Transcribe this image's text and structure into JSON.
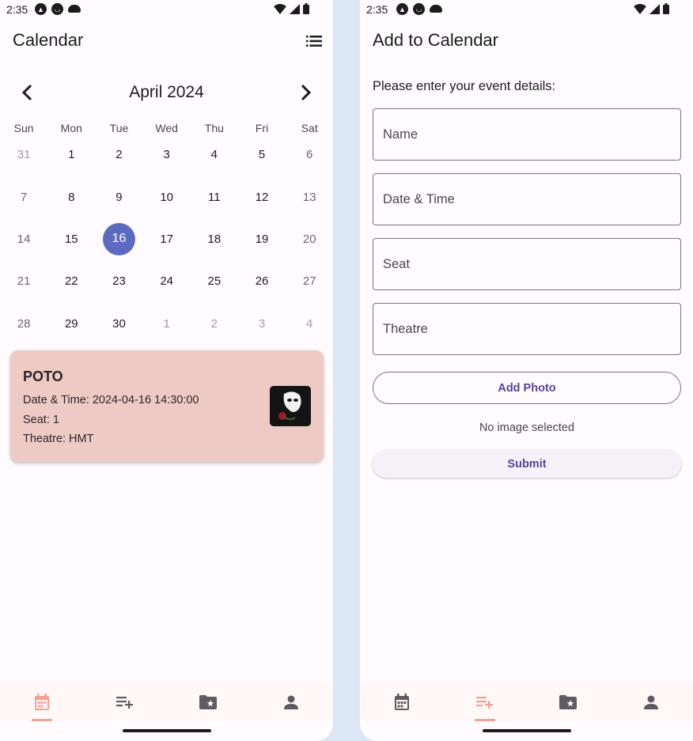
{
  "status_bar": {
    "time": "2:35"
  },
  "calendar_screen": {
    "title": "Calendar",
    "month_label": "April 2024",
    "weekdays": [
      "Sun",
      "Mon",
      "Tue",
      "Wed",
      "Thu",
      "Fri",
      "Sat"
    ],
    "weeks": [
      [
        "31",
        "1",
        "2",
        "3",
        "4",
        "5",
        "6"
      ],
      [
        "7",
        "8",
        "9",
        "10",
        "11",
        "12",
        "13"
      ],
      [
        "14",
        "15",
        "16",
        "17",
        "18",
        "19",
        "20"
      ],
      [
        "21",
        "22",
        "23",
        "24",
        "25",
        "26",
        "27"
      ],
      [
        "28",
        "29",
        "30",
        "1",
        "2",
        "3",
        "4"
      ]
    ],
    "selected_day": "16",
    "event": {
      "name": "POTO",
      "datetime": "Date & Time: 2024-04-16 14:30:00",
      "seat": "Seat: 1",
      "theatre": "Theatre: HMT"
    }
  },
  "add_screen": {
    "title": "Add to Calendar",
    "prompt": "Please enter your event details:",
    "fields": {
      "name": {
        "placeholder": "Name",
        "value": ""
      },
      "datetime": {
        "placeholder": "Date & Time",
        "value": ""
      },
      "seat": {
        "placeholder": "Seat",
        "value": ""
      },
      "theatre": {
        "placeholder": "Theatre",
        "value": ""
      }
    },
    "add_photo_label": "Add Photo",
    "no_image_text": "No image selected",
    "submit_label": "Submit"
  },
  "bottom_nav": {
    "items": [
      "calendar-icon",
      "playlist-add-icon",
      "folder-star-icon",
      "person-icon"
    ],
    "active_color": "#f4a092",
    "inactive_color": "#5f5b62"
  },
  "colors": {
    "selected_day": "#5c6bc0",
    "event_card": "#eecac5",
    "accent_purple": "#5a4296"
  }
}
